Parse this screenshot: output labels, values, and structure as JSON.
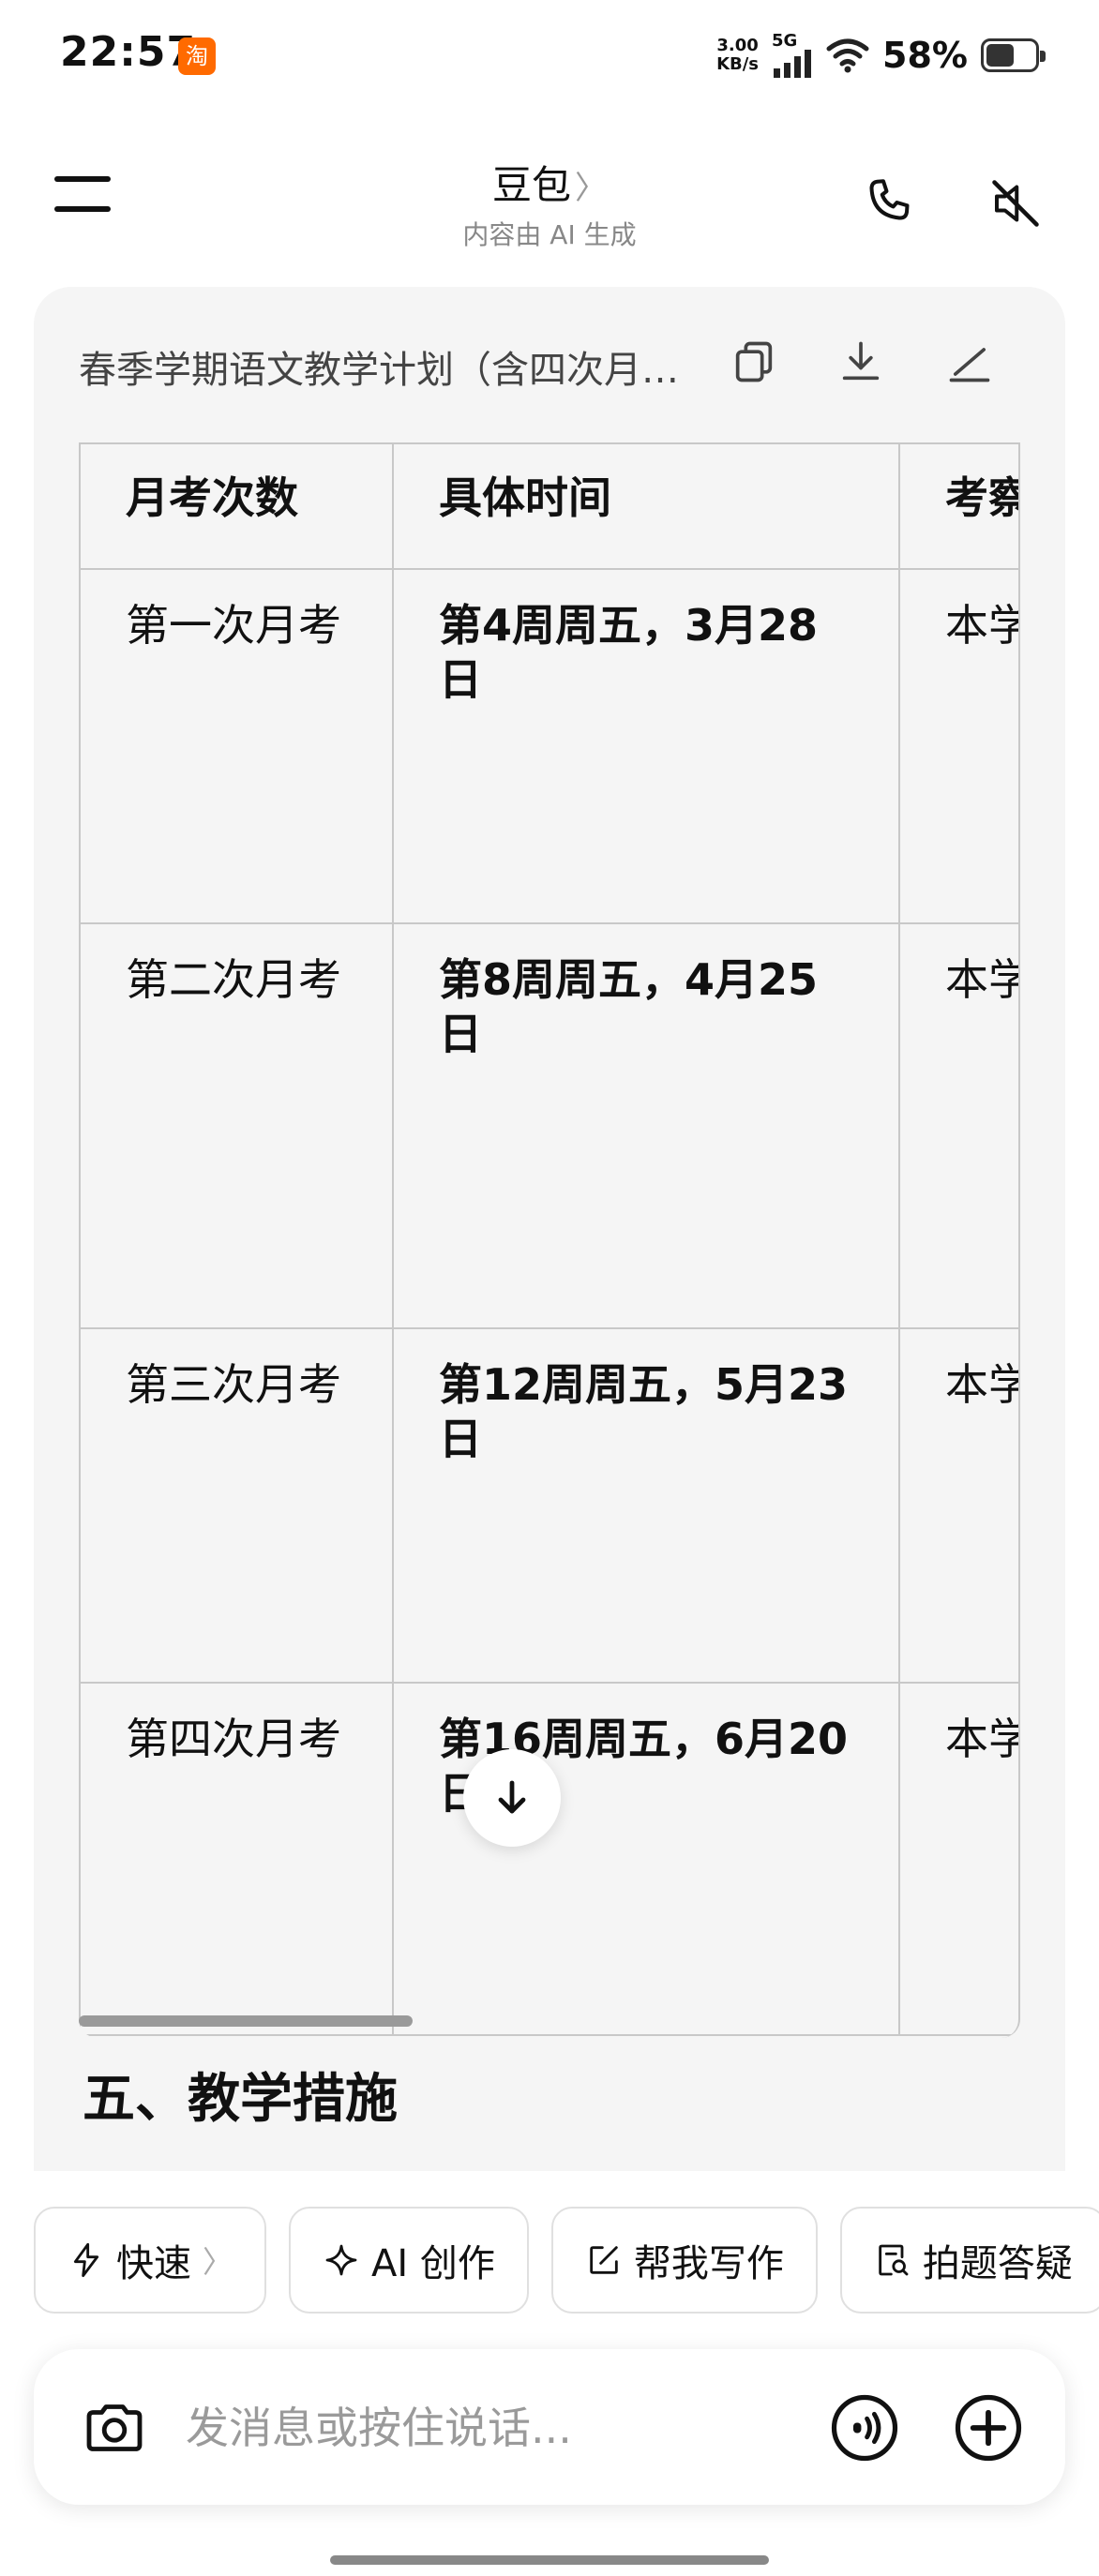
{
  "status_bar": {
    "time": "22:57",
    "app_badge": "淘",
    "net_speed_value": "3.00",
    "net_speed_unit": "KB/s",
    "network": "5G",
    "battery_percent": "58%",
    "battery_level": 0.58
  },
  "header": {
    "title": "豆包",
    "title_chevron": "〉",
    "subtitle": "内容由 AI 生成",
    "icons": [
      "menu-icon",
      "phone-icon",
      "speaker-mute-icon"
    ]
  },
  "document": {
    "title": "春季学期语文教学计划（含四次月考安排）",
    "actions": [
      "copy-icon",
      "download-icon",
      "edit-icon"
    ],
    "table": {
      "headers": [
        "月考次数",
        "具体时间",
        "考察"
      ],
      "rows": [
        [
          "第一次月考",
          "第4周周五，3月28日",
          "本学部内"
        ],
        [
          "第二次月考",
          "第8周周五，4月25日",
          "本学容"
        ],
        [
          "第三次月考",
          "第12周周五，5月23日",
          "本学（不"
        ],
        [
          "第四次月考",
          "第16周周五，6月20日",
          "本学（含"
        ]
      ]
    },
    "next_section_heading": "五、教学措施"
  },
  "chips": [
    {
      "label": "快速",
      "icon": "bolt-icon",
      "chevron": "〉"
    },
    {
      "label": "AI 创作",
      "icon": "sparkle-icon"
    },
    {
      "label": "帮我写作",
      "icon": "write-icon"
    },
    {
      "label": "拍题答疑",
      "icon": "scan-question-icon"
    }
  ],
  "input": {
    "placeholder": "发消息或按住说话...",
    "icons": [
      "camera-icon",
      "voice-call-icon",
      "add-icon"
    ]
  }
}
